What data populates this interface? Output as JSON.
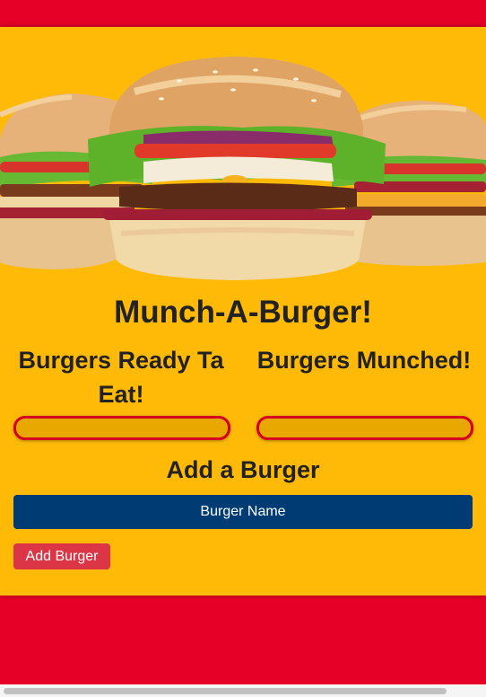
{
  "header": {
    "title": "Munch-A-Burger!"
  },
  "columns": {
    "ready_title": "Burgers Ready Ta Eat!",
    "munched_title": "Burgers Munched!"
  },
  "form": {
    "title": "Add a Burger",
    "input_placeholder": "Burger Name",
    "input_value": "",
    "submit_label": "Add Burger"
  },
  "colors": {
    "page_background": "#e60028",
    "panel_background": "#ffba08",
    "input_background": "#003b73",
    "button_background": "#dc3545",
    "list_border": "#d4001f"
  }
}
